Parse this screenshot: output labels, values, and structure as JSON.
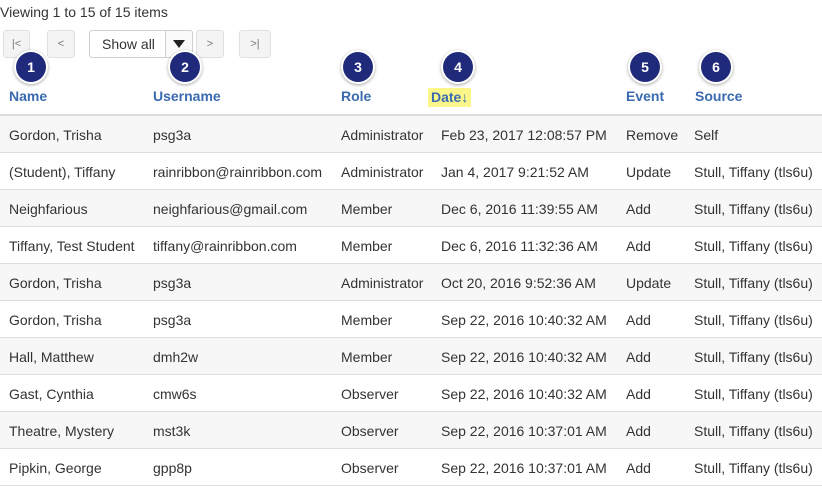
{
  "summary": "Viewing 1 to 15 of 15 items",
  "pager": {
    "first": "|<",
    "prev": "<",
    "select_value": "Show all",
    "next": ">",
    "last": ">|"
  },
  "badges": [
    "1",
    "2",
    "3",
    "4",
    "5",
    "6"
  ],
  "columns": {
    "name": "Name",
    "username": "Username",
    "role": "Role",
    "date": "Date↓",
    "event": "Event",
    "source": "Source"
  },
  "highlight_color": "#fbf68a",
  "badge_color": "#1f2a7a",
  "rows": [
    {
      "name": "Gordon, Trisha",
      "username": "psg3a",
      "role": "Administrator",
      "date": "Feb 23, 2017 12:08:57 PM",
      "event": "Remove",
      "source": "Self"
    },
    {
      "name": "(Student), Tiffany",
      "username": "rainribbon@rainribbon.com",
      "role": "Administrator",
      "date": "Jan 4, 2017 9:21:52 AM",
      "event": "Update",
      "source": "Stull, Tiffany (tls6u)"
    },
    {
      "name": "Neighfarious",
      "username": "neighfarious@gmail.com",
      "role": "Member",
      "date": "Dec 6, 2016 11:39:55 AM",
      "event": "Add",
      "source": "Stull, Tiffany (tls6u)"
    },
    {
      "name": "Tiffany, Test Student",
      "username": "tiffany@rainribbon.com",
      "role": "Member",
      "date": "Dec 6, 2016 11:32:36 AM",
      "event": "Add",
      "source": "Stull, Tiffany (tls6u)"
    },
    {
      "name": "Gordon, Trisha",
      "username": "psg3a",
      "role": "Administrator",
      "date": "Oct 20, 2016 9:52:36 AM",
      "event": "Update",
      "source": "Stull, Tiffany (tls6u)"
    },
    {
      "name": "Gordon, Trisha",
      "username": "psg3a",
      "role": "Member",
      "date": "Sep 22, 2016 10:40:32 AM",
      "event": "Add",
      "source": "Stull, Tiffany (tls6u)"
    },
    {
      "name": "Hall, Matthew",
      "username": "dmh2w",
      "role": "Member",
      "date": "Sep 22, 2016 10:40:32 AM",
      "event": "Add",
      "source": "Stull, Tiffany (tls6u)"
    },
    {
      "name": "Gast, Cynthia",
      "username": "cmw6s",
      "role": "Observer",
      "date": "Sep 22, 2016 10:40:32 AM",
      "event": "Add",
      "source": "Stull, Tiffany (tls6u)"
    },
    {
      "name": "Theatre, Mystery",
      "username": "mst3k",
      "role": "Observer",
      "date": "Sep 22, 2016 10:37:01 AM",
      "event": "Add",
      "source": "Stull, Tiffany (tls6u)"
    },
    {
      "name": "Pipkin, George",
      "username": "gpp8p",
      "role": "Observer",
      "date": "Sep 22, 2016 10:37:01 AM",
      "event": "Add",
      "source": "Stull, Tiffany (tls6u)"
    }
  ]
}
